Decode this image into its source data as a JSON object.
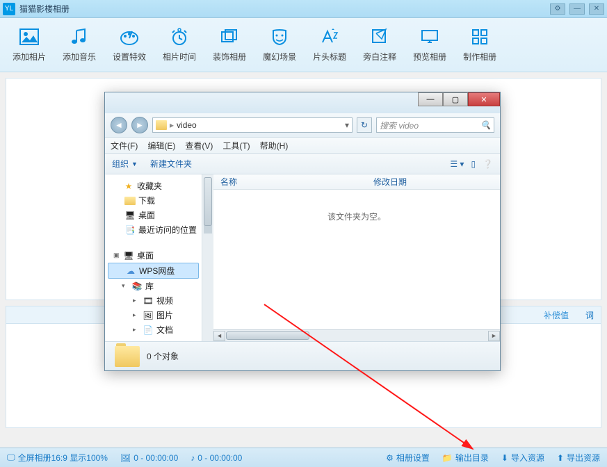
{
  "app": {
    "logo": "YL",
    "title": "猫猫影楼相册"
  },
  "toolbar": [
    {
      "id": "add-photo",
      "label": "添加相片"
    },
    {
      "id": "add-music",
      "label": "添加音乐"
    },
    {
      "id": "set-effect",
      "label": "设置特效"
    },
    {
      "id": "photo-time",
      "label": "相片时间"
    },
    {
      "id": "deco-album",
      "label": "装饰相册"
    },
    {
      "id": "magic-scene",
      "label": "魔幻场景"
    },
    {
      "id": "title",
      "label": "片头标题"
    },
    {
      "id": "comment",
      "label": "旁白注释"
    },
    {
      "id": "preview",
      "label": "预览相册"
    },
    {
      "id": "make",
      "label": "制作相册"
    }
  ],
  "tabs": {
    "comp": "补偿值",
    "ci": "词"
  },
  "status": {
    "screen": "全屏相册16:9 显示100%",
    "img": "0 - 00:00:00",
    "audio": "0 - 00:00:00",
    "settings": "相册设置",
    "output": "输出目录",
    "import": "导入资源",
    "export": "导出资源"
  },
  "dialog": {
    "path_crumb": "video",
    "search_placeholder": "搜索 video",
    "menu": [
      "文件(F)",
      "编辑(E)",
      "查看(V)",
      "工具(T)",
      "帮助(H)"
    ],
    "organize": "组织",
    "newfolder": "新建文件夹",
    "tree": {
      "fav": "收藏夹",
      "downloads": "下载",
      "desktop_f": "桌面",
      "recent": "最近访问的位置",
      "desktop": "桌面",
      "wps": "WPS网盘",
      "lib": "库",
      "video": "视频",
      "pics": "图片",
      "docs": "文档"
    },
    "cols": {
      "name": "名称",
      "date": "修改日期"
    },
    "empty": "该文件夹为空。",
    "foot": "0 个对象"
  }
}
